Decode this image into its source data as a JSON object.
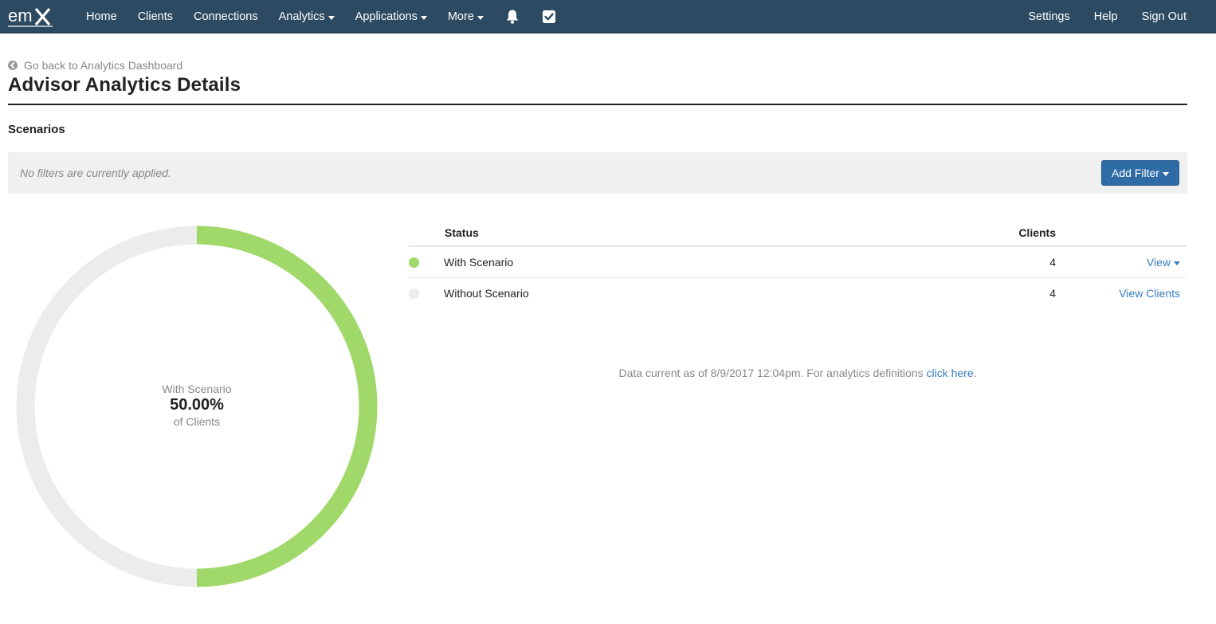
{
  "nav": {
    "logo_text": "emX",
    "left_items": [
      {
        "label": "Home"
      },
      {
        "label": "Clients"
      },
      {
        "label": "Connections"
      },
      {
        "label": "Analytics"
      },
      {
        "label": "Applications"
      },
      {
        "label": "More"
      }
    ],
    "icons": [
      "bell-icon",
      "checkbox-icon"
    ],
    "right_items": [
      {
        "label": "Settings"
      },
      {
        "label": "Help"
      },
      {
        "label": "Sign Out"
      }
    ]
  },
  "back_link": "Go back to Analytics Dashboard",
  "page_title": "Advisor Analytics Details",
  "section_title": "Scenarios",
  "filter": {
    "message": "No filters are currently applied.",
    "button_label": "Add Filter"
  },
  "chart_data": {
    "type": "pie",
    "style": "donut",
    "slices": [
      {
        "label": "With Scenario",
        "value": 4,
        "color": "#a0d86a"
      },
      {
        "label": "Without Scenario",
        "value": 4,
        "color": "#ececec"
      }
    ],
    "center_label": "With Scenario",
    "center_value": "50.00%",
    "center_sublabel": "of Clients"
  },
  "table": {
    "headers": {
      "status": "Status",
      "clients": "Clients"
    },
    "rows": [
      {
        "status": "With Scenario",
        "count": "4",
        "action": "View",
        "dot_color": "#a0d86a"
      },
      {
        "status": "Without Scenario",
        "count": "4",
        "action": "View Clients",
        "dot_color": "#ececec"
      }
    ]
  },
  "footnote": {
    "text": "Data current as of 8/9/2017 12:04pm. For analytics definitions ",
    "link": "click here",
    "suffix": "."
  },
  "colors": {
    "navbar": "#2c4a62",
    "accent": "#2f6ca6",
    "link": "#3b7dbf",
    "scenario_green": "#a0d86a",
    "empty_grey": "#ececec"
  }
}
